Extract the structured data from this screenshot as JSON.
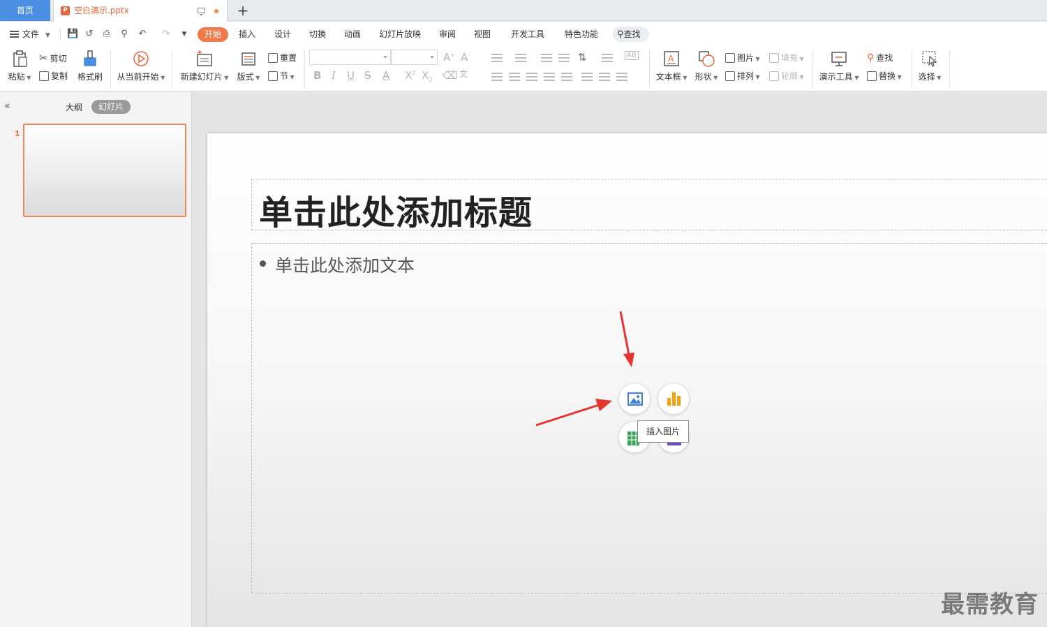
{
  "tabs": {
    "home": "首页",
    "document": "空白演示.pptx",
    "new_tab": "+"
  },
  "menu": {
    "file": "文件",
    "items": [
      "开始",
      "插入",
      "设计",
      "切换",
      "动画",
      "幻灯片放映",
      "审阅",
      "视图",
      "开发工具",
      "特色功能"
    ],
    "active": "开始",
    "search": "查找"
  },
  "ribbon": {
    "paste": "粘贴",
    "cut": "剪切",
    "copy": "复制",
    "format_painter": "格式刷",
    "play_from_current": "从当前开始",
    "new_slide": "新建幻灯片",
    "layout": "版式",
    "reset": "重置",
    "section": "节",
    "textbox": "文本框",
    "shape": "形状",
    "picture": "图片",
    "fill": "填充",
    "arrange": "排列",
    "outline": "轮廓",
    "presentation_tools": "演示工具",
    "find": "查找",
    "replace": "替换",
    "select": "选择"
  },
  "left_pane": {
    "outline_tab": "大纲",
    "slides_tab": "幻灯片",
    "slide_number": "1"
  },
  "slide": {
    "title_placeholder": "单击此处添加标题",
    "body_placeholder": "单击此处添加文本"
  },
  "content_buttons": {
    "picture_icon": "picture-icon",
    "chart_icon": "chart-icon",
    "table_icon": "table-icon",
    "media_icon": "media-icon",
    "tooltip": "插入图片"
  },
  "colors": {
    "accent_orange": "#f07a4a",
    "home_tab_blue": "#4a8fe3",
    "arrow_red": "#e8322e"
  },
  "watermark": "最需教育"
}
